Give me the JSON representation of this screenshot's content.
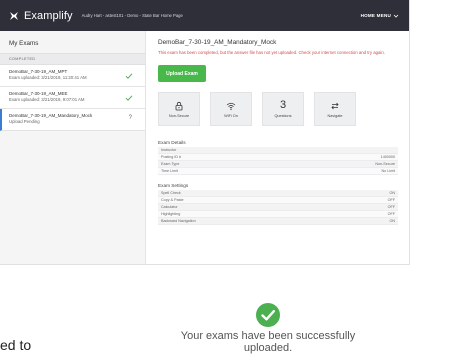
{
  "topbar": {
    "app_name": "Examplify",
    "user_info": "Audry Hart - astest101 - Demo - State Bar Home Page",
    "home_menu": "HOME MENU"
  },
  "sidebar": {
    "title": "My Exams",
    "section_label": "COMPLETED",
    "exams": [
      {
        "name": "DemoBar_7-30-19_AM_MPT",
        "status": "Exam uploaded: 3/21/2019, 11:20:41 AM",
        "indicator": "check"
      },
      {
        "name": "DemoBar_7-30-19_AM_MEE",
        "status": "Exam uploaded: 3/21/2019, 9:07:01 AM",
        "indicator": "check"
      },
      {
        "name": "DemoBar_7-30-19_AM_Mandatory_Mock",
        "status": "Upload Pending",
        "indicator": "?"
      }
    ]
  },
  "main": {
    "title": "DemoBar_7-30-19_AM_Mandatory_Mock",
    "notice": "This exam has been completed, but the answer file has not yet uploaded. Check your internet connection and try again.",
    "upload_button": "Upload Exam",
    "tiles": [
      {
        "icon": "lock-icon",
        "label": "Non-Secure"
      },
      {
        "icon": "wifi-icon",
        "label": "WiFi On"
      },
      {
        "number": "3",
        "label": "Questions"
      },
      {
        "icon": "navigate-arrows-icon",
        "label": "Navigate"
      }
    ],
    "details_title": "Exam Details",
    "details": [
      {
        "key": "Instructor",
        "value": ""
      },
      {
        "key": "Posting ID #",
        "value": "1400000"
      },
      {
        "key": "Exam Type",
        "value": "Non-Secure"
      },
      {
        "key": "Time Limit",
        "value": "No Limit"
      }
    ],
    "settings_title": "Exam Settings",
    "settings": [
      {
        "key": "Spell Check",
        "value": "ON"
      },
      {
        "key": "Copy & Paste",
        "value": "OFF"
      },
      {
        "key": "Calculator",
        "value": "OFF"
      },
      {
        "key": "Highlighting",
        "value": "OFF"
      },
      {
        "key": "Backward Navigation",
        "value": "ON"
      }
    ]
  },
  "success_message": "Your exams have been successfully uploaded.",
  "edge_text": "ed to",
  "colors": {
    "topbar": "#2f2f3a",
    "upload_button": "#48b84b",
    "success": "#4caf50",
    "notice": "#d44c4c",
    "active_accent": "#3b7bd6"
  }
}
